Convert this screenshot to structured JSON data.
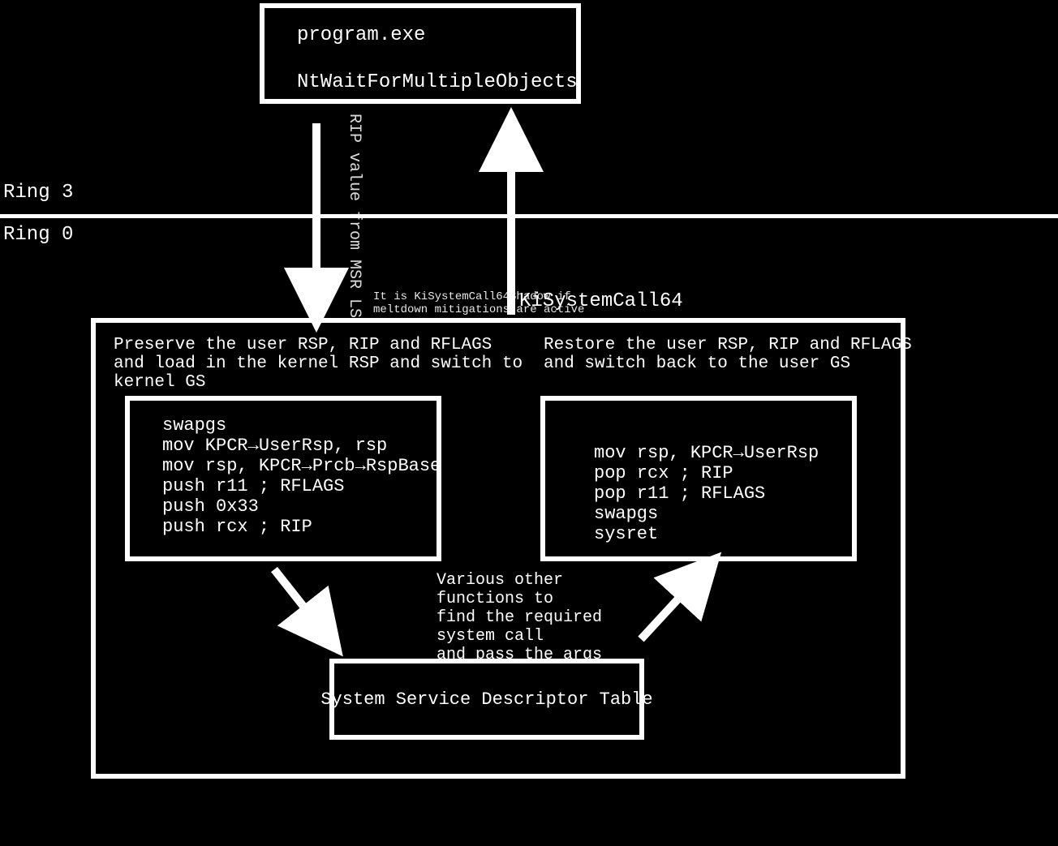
{
  "program_box": {
    "title": "program.exe",
    "api": "NtWaitForMultipleObjects"
  },
  "rings": {
    "ring3": "Ring 3",
    "ring0": "Ring 0"
  },
  "rip_label": "RIP value from MSR LSTAR",
  "shadow_note_line1": "It is KiSystemCall64Shadow if",
  "shadow_note_line2": "meltdown mitigations are active",
  "handler_name": "KiSystemCall64",
  "entry": {
    "desc": "Preserve the user RSP, RIP and RFLAGS\nand load in the kernel RSP and switch to\nkernel GS",
    "code": "swapgs\nmov KPCR→UserRsp, rsp\nmov rsp, KPCR→Prcb→RspBase\npush r11 ; RFLAGS\npush 0x33\npush rcx ; RIP"
  },
  "exit": {
    "desc": "Restore the user RSP, RIP and RFLAGS\nand switch back to the user GS",
    "code": "mov rsp, KPCR→UserRsp\npop rcx ; RIP\npop r11 ; RFLAGS\nswapgs\nsysret"
  },
  "middle_note": "Various other\nfunctions to\nfind the required\nsystem call\nand pass the args",
  "ssdt": "System Service Descriptor Table"
}
